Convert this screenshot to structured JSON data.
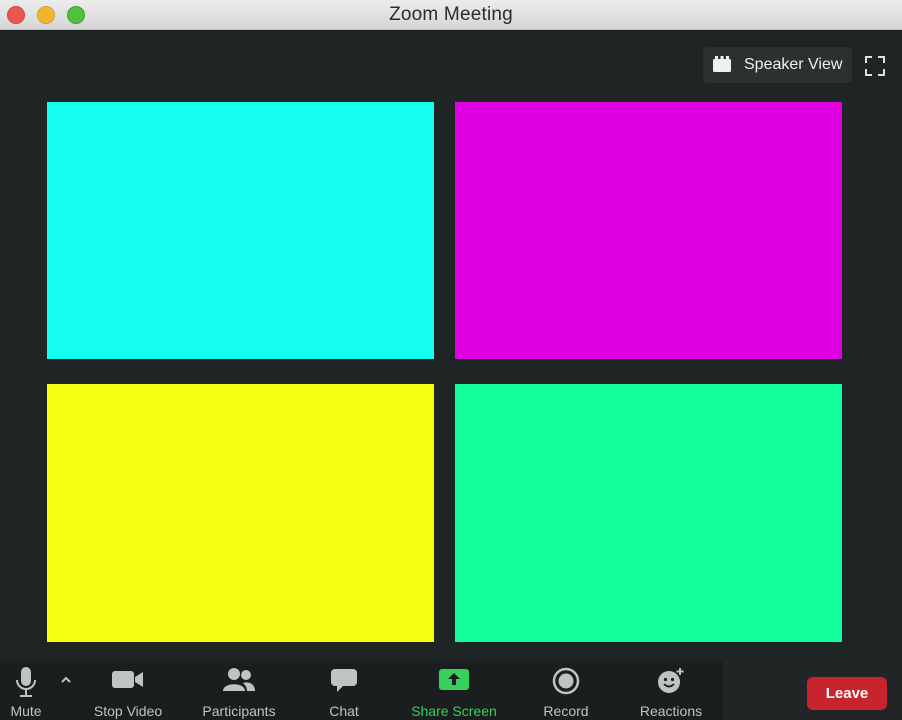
{
  "window": {
    "title": "Zoom Meeting"
  },
  "top_controls": {
    "view_label": "Speaker View"
  },
  "tiles": [
    {
      "color": "#14fff0"
    },
    {
      "color": "#e000e4"
    },
    {
      "color": "#f8ff12"
    },
    {
      "color": "#14ff9e"
    }
  ],
  "toolbar": {
    "mute": "Mute",
    "stop_video": "Stop Video",
    "participants": "Participants",
    "chat": "Chat",
    "share_screen": "Share Screen",
    "record": "Record",
    "reactions": "Reactions",
    "leave": "Leave"
  },
  "colors": {
    "share_accent": "#36d15c",
    "leave_red": "#c8242e"
  }
}
